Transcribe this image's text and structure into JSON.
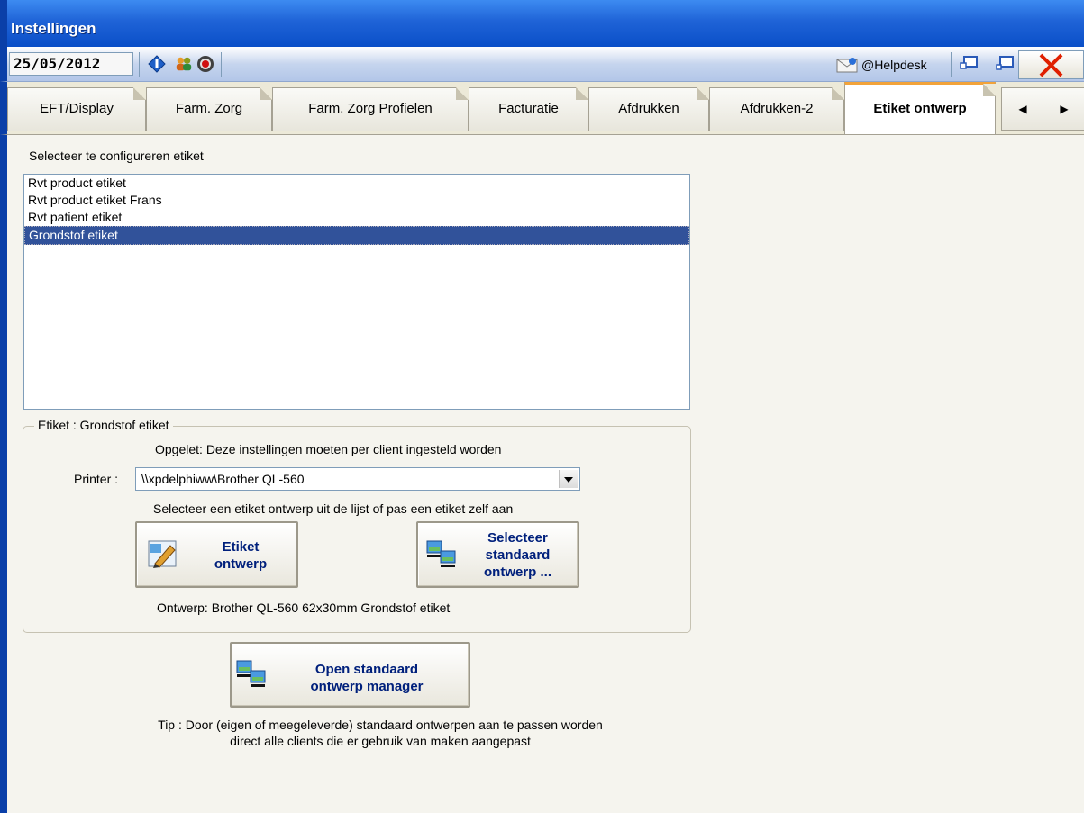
{
  "window": {
    "title": "Instellingen"
  },
  "toolbar": {
    "date": "25/05/2012",
    "helpdesk_label": "@Helpdesk"
  },
  "tabs": [
    {
      "label": "EFT/Display",
      "active": false
    },
    {
      "label": "Farm. Zorg",
      "active": false
    },
    {
      "label": "Farm. Zorg Profielen",
      "active": false
    },
    {
      "label": "Facturatie",
      "active": false
    },
    {
      "label": "Afdrukken",
      "active": false
    },
    {
      "label": "Afdrukken-2",
      "active": false
    },
    {
      "label": "Etiket ontwerp",
      "active": true
    }
  ],
  "main": {
    "select_label": "Selecteer te configureren etiket",
    "labels_list": [
      "Rvt product etiket",
      "Rvt product etiket Frans",
      "Rvt patient etiket",
      "Grondstof etiket"
    ],
    "selected_index": 3,
    "group": {
      "legend": "Etiket : Grondstof etiket",
      "warning": "Opgelet: Deze instellingen moeten per client ingesteld worden",
      "printer_label": "Printer :",
      "printer_value": "\\\\xpdelphiww\\Brother QL-560",
      "instruction": "Selecteer een etiket ontwerp uit de lijst of pas een etiket zelf aan",
      "design_button": [
        "Etiket",
        "ontwerp"
      ],
      "select_standard_button": [
        "Selecteer",
        "standaard",
        "ontwerp ..."
      ],
      "design_info": "Ontwerp: Brother QL-560 62x30mm Grondstof etiket"
    },
    "manager_button": [
      "Open standaard",
      "ontwerp manager"
    ],
    "tip_lines": [
      "Tip : Door (eigen of meegeleverde) standaard ontwerpen aan te passen worden",
      "direct alle clients die er gebruik van maken aangepast"
    ]
  },
  "colors": {
    "titlebar": "#1F63D7",
    "selection": "#31529A",
    "button_text": "#00207C",
    "active_tab_accent": "#F2A33A",
    "close_x": "#E02000"
  }
}
